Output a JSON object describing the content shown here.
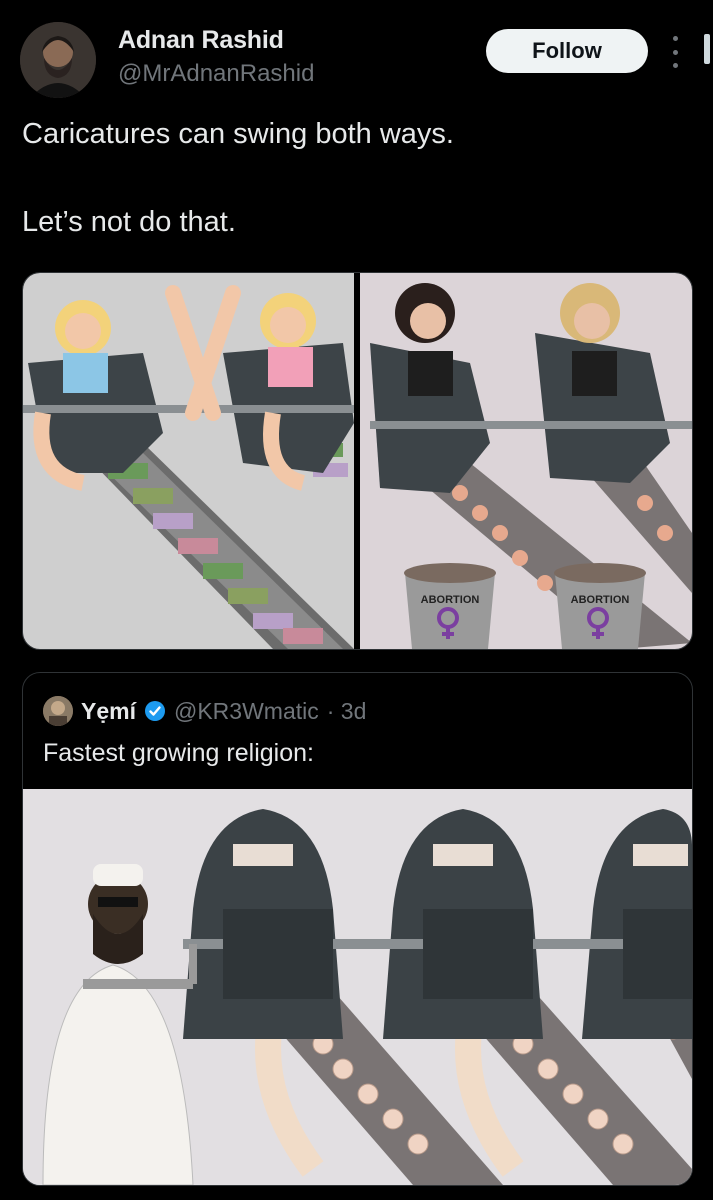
{
  "author": {
    "name": "Adnan Rashid",
    "handle": "@MrAdnanRashid",
    "follow_label": "Follow"
  },
  "tweet": {
    "text": "Caricatures can swing both ways.\n\nLet’s not do that."
  },
  "media": [
    {
      "type": "cartoon",
      "labels": []
    },
    {
      "type": "cartoon",
      "labels": [
        "ABORTION",
        "ABORTION"
      ]
    }
  ],
  "quote": {
    "name": "Yẹmí",
    "verified": true,
    "handle": "@KR3Wmatic",
    "age": "· 3d",
    "text": "Fastest growing religion:"
  },
  "colors": {
    "background": "#000000",
    "text": "#e7e9ea",
    "secondary": "#71767b",
    "verified_blue": "#1d9bf0",
    "border": "#2f3336",
    "feminist_purple": "#7b3fa0"
  },
  "icons": [
    "more-icon",
    "verified-badge-icon",
    "venus-fist-icon"
  ]
}
